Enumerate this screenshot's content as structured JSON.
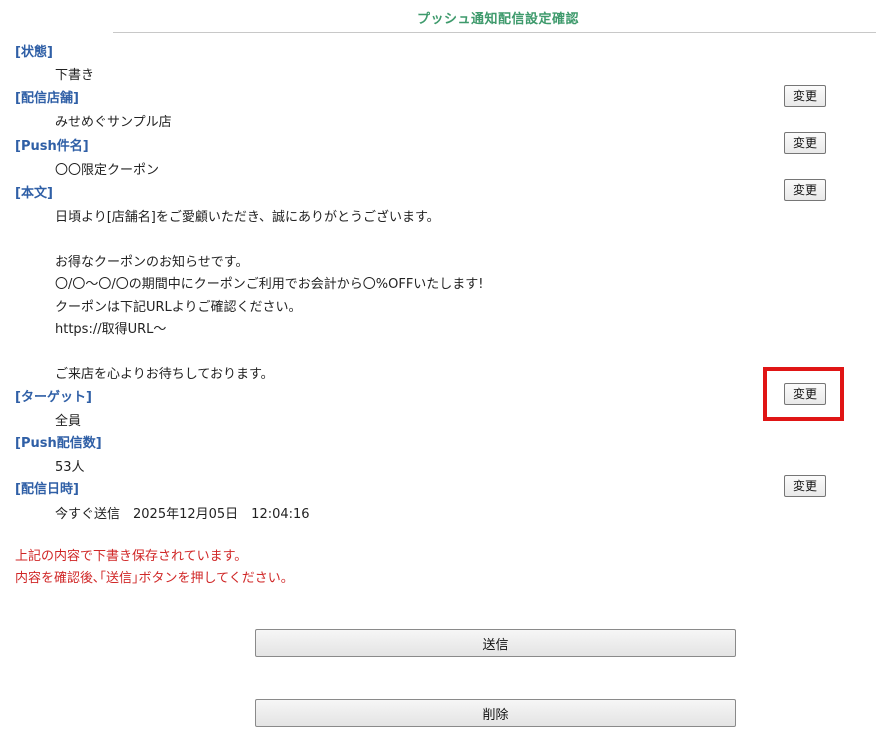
{
  "page": {
    "title": "プッシュ通知配信設定確認"
  },
  "fields": {
    "status": {
      "label": "[状態]",
      "value": "下書き"
    },
    "store": {
      "label": "[配信店舗]",
      "value": "みせめぐサンプル店",
      "change_label": "変更"
    },
    "push_title": {
      "label": "[Push件名]",
      "value": "〇〇限定クーポン",
      "change_label": "変更"
    },
    "body": {
      "label": "[本文]",
      "change_label": "変更",
      "lines": [
        "日頃より[店舗名]をご愛顧いただき、誠にありがとうございます。",
        "",
        "お得なクーポンのお知らせです。",
        "〇/〇〜〇/〇の期間中にクーポンご利用でお会計から〇%OFFいたします!",
        "クーポンは下記URLよりご確認ください。",
        "https://取得URL〜",
        "",
        "ご来店を心よりお待ちしております。"
      ]
    },
    "target": {
      "label": "[ターゲット]",
      "value": "全員",
      "change_label": "変更"
    },
    "push_count": {
      "label": "[Push配信数]",
      "value": "53人"
    },
    "send_datetime": {
      "label": "[配信日時]",
      "value": "今すぐ送信　2025年12月05日　12:04:16",
      "change_label": "変更"
    }
  },
  "notice": {
    "line1": "上記の内容で下書き保存されています。",
    "line2": "内容を確認後､｢送信｣ボタンを押してください。"
  },
  "actions": {
    "send_label": "送信",
    "delete_label": "削除"
  }
}
